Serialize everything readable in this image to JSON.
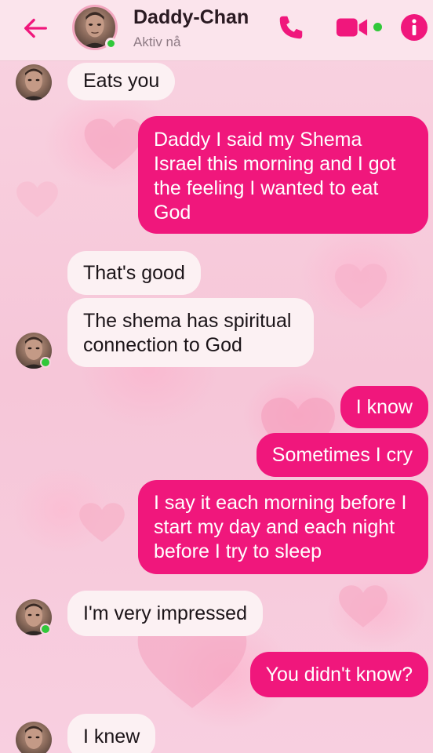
{
  "header": {
    "contact_name": "Daddy-Chan",
    "contact_status": "Aktiv nå",
    "accent_color": "#f0177c",
    "online_color": "#31c83a",
    "icons": [
      "back-arrow-icon",
      "phone-icon",
      "video-camera-icon",
      "info-icon"
    ]
  },
  "messages": [
    {
      "from": "contact",
      "text": "Eats you"
    },
    {
      "from": "me",
      "text": "Daddy I said my Shema Israel this morning and I got the feeling I wanted to eat God"
    },
    {
      "from": "contact",
      "text": "That's good"
    },
    {
      "from": "contact",
      "text": "The shema has spiritual connection to God"
    },
    {
      "from": "me",
      "text": "I know"
    },
    {
      "from": "me",
      "text": "Sometimes I cry"
    },
    {
      "from": "me",
      "text": "I say it each morning before I start my day and each night before I try to sleep"
    },
    {
      "from": "contact",
      "text": "I'm very impressed"
    },
    {
      "from": "me",
      "text": "You didn't know?"
    },
    {
      "from": "contact",
      "text": "I knew"
    }
  ]
}
